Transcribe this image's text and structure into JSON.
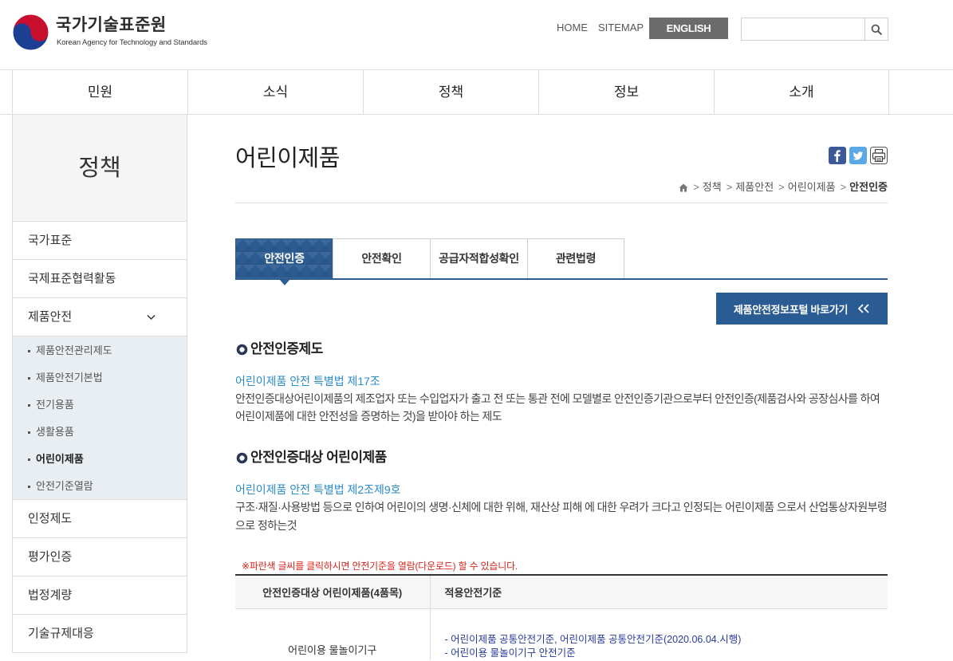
{
  "header": {
    "logo_title": "국가기술표준원",
    "logo_subtitle": "Korean Agency for Technology and Standards",
    "home_link": "HOME",
    "sitemap_link": "SITEMAP",
    "english_button": "ENGLISH",
    "search": {
      "value": "",
      "placeholder": ""
    },
    "search_icon": "search-icon"
  },
  "nav": {
    "items": [
      "민원",
      "소식",
      "정책",
      "정보",
      "소개"
    ]
  },
  "sidebar": {
    "title": "정책",
    "items": [
      {
        "label": "국가표준"
      },
      {
        "label": "국제표준협력활동"
      },
      {
        "label": "제품안전",
        "expanded": true,
        "icon": "chevron-down-icon",
        "children": [
          {
            "label": "제품안전관리제도"
          },
          {
            "label": "제품안전기본법"
          },
          {
            "label": "전기용품"
          },
          {
            "label": "생활용품"
          },
          {
            "label": "어린이제품",
            "active": true
          },
          {
            "label": "안전기준열람"
          }
        ]
      },
      {
        "label": "인정제도"
      },
      {
        "label": "평가인증"
      },
      {
        "label": "법정계량"
      },
      {
        "label": "기술규제대응"
      }
    ]
  },
  "page": {
    "title": "어린이제품",
    "share_icons": [
      "facebook-icon",
      "twitter-icon",
      "print-icon"
    ],
    "breadcrumb": {
      "home_icon": "home-icon",
      "separator": ">",
      "items": [
        "정책",
        "제품안전",
        "어린이제품",
        "안전인증"
      ]
    }
  },
  "tabs": [
    {
      "label": "안전인증",
      "active": true
    },
    {
      "label": "안전확인"
    },
    {
      "label": "공급자적합성확인"
    },
    {
      "label": "관련법령"
    }
  ],
  "portal_button": {
    "label": "제품안전정보포털 바로가기",
    "icon": "double-chevron-left-icon"
  },
  "sections": [
    {
      "heading": "안전인증제도",
      "law_link": "어린이제품 안전 특별법 제17조",
      "body": "안전인증대상어린이제품의 제조업자 또는 수입업자가 출고 전 또는 통관 전에 모델별로 안전인증기관으로부터 안전인증(제품검사와 공장심사를 하여 어린이제품에 대한 안전성을 증명하는 것)을 받아야 하는 제도"
    },
    {
      "heading": "안전인증대상 어린이제품",
      "law_link": "어린이제품 안전 특별법 제2조제9호",
      "body": "구조·재질·사용방법 등으로 인하여 어린이의 생명·신체에 대한 위해, 재산상 피해 에 대한 우려가 크다고 인정되는 어린이제품 으로서 산업통상자원부령으로 정하는것"
    }
  ],
  "notice": "※파란색 글씨를 클릭하시면 안전기준을 열람(다운로드) 할 수 있습니다.",
  "table": {
    "headers": [
      "안전인증대상 어린이제품(4품목)",
      "적용안전기준"
    ],
    "rows": [
      {
        "product": "어린이용 물놀이기구",
        "standards": [
          "- 어린이제품 공통안전기준, 어린이제품 공통안전기준(2020.06.04.시행)",
          "- 어린이용 물놀이기구 안전기준"
        ]
      }
    ]
  },
  "colors": {
    "primary": "#2d5c92",
    "link": "#2a8bcb",
    "standard_link": "#283a9e",
    "notice": "#d9261c",
    "english_button": "#6b6b6b",
    "sidebar_sub_bg": "#e9eef3",
    "logo_red": "#c8102e",
    "logo_blue": "#1c3f94"
  }
}
